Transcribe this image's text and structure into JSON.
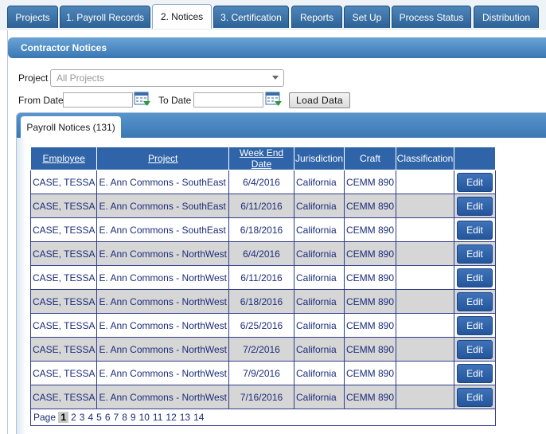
{
  "tabs": [
    {
      "label": "Projects",
      "active": false
    },
    {
      "label": "1. Payroll Records",
      "active": false
    },
    {
      "label": "2. Notices",
      "active": true
    },
    {
      "label": "3. Certification",
      "active": false
    },
    {
      "label": "Reports",
      "active": false
    },
    {
      "label": "Set Up",
      "active": false
    },
    {
      "label": "Process Status",
      "active": false
    },
    {
      "label": "Distribution",
      "active": false
    }
  ],
  "section": {
    "title": "Contractor Notices"
  },
  "filters": {
    "project_label": "Project",
    "project_placeholder": "All Projects",
    "from_label": "From Date",
    "from_value": "",
    "to_label": "To Date",
    "to_value": "",
    "load_label": "Load Data"
  },
  "panel": {
    "tab_label": "Payroll Notices (131)"
  },
  "grid": {
    "columns": [
      "Employee",
      "Project",
      "Week End Date",
      "Jurisdiction",
      "Craft",
      "Classification",
      ""
    ],
    "rows": [
      {
        "employee": "CASE, TESSA",
        "project": "E. Ann Commons - SouthEast",
        "week_end": "6/4/2016",
        "jurisdiction": "California",
        "craft": "CEMM 890",
        "classification": "",
        "action": "Edit"
      },
      {
        "employee": "CASE, TESSA",
        "project": "E. Ann Commons - SouthEast",
        "week_end": "6/11/2016",
        "jurisdiction": "California",
        "craft": "CEMM 890",
        "classification": "",
        "action": "Edit"
      },
      {
        "employee": "CASE, TESSA",
        "project": "E. Ann Commons - SouthEast",
        "week_end": "6/18/2016",
        "jurisdiction": "California",
        "craft": "CEMM 890",
        "classification": "",
        "action": "Edit"
      },
      {
        "employee": "CASE, TESSA",
        "project": "E. Ann Commons - NorthWest",
        "week_end": "6/4/2016",
        "jurisdiction": "California",
        "craft": "CEMM 890",
        "classification": "",
        "action": "Edit"
      },
      {
        "employee": "CASE, TESSA",
        "project": "E. Ann Commons - NorthWest",
        "week_end": "6/11/2016",
        "jurisdiction": "California",
        "craft": "CEMM 890",
        "classification": "",
        "action": "Edit"
      },
      {
        "employee": "CASE, TESSA",
        "project": "E. Ann Commons - NorthWest",
        "week_end": "6/18/2016",
        "jurisdiction": "California",
        "craft": "CEMM 890",
        "classification": "",
        "action": "Edit"
      },
      {
        "employee": "CASE, TESSA",
        "project": "E. Ann Commons - NorthWest",
        "week_end": "6/25/2016",
        "jurisdiction": "California",
        "craft": "CEMM 890",
        "classification": "",
        "action": "Edit"
      },
      {
        "employee": "CASE, TESSA",
        "project": "E. Ann Commons - NorthWest",
        "week_end": "7/2/2016",
        "jurisdiction": "California",
        "craft": "CEMM 890",
        "classification": "",
        "action": "Edit"
      },
      {
        "employee": "CASE, TESSA",
        "project": "E. Ann Commons - NorthWest",
        "week_end": "7/9/2016",
        "jurisdiction": "California",
        "craft": "CEMM 890",
        "classification": "",
        "action": "Edit"
      },
      {
        "employee": "CASE, TESSA",
        "project": "E. Ann Commons - NorthWest",
        "week_end": "7/16/2016",
        "jurisdiction": "California",
        "craft": "CEMM 890",
        "classification": "",
        "action": "Edit"
      }
    ]
  },
  "pager": {
    "label": "Page",
    "pages": [
      "1",
      "2",
      "3",
      "4",
      "5",
      "6",
      "7",
      "8",
      "9",
      "10",
      "11",
      "12",
      "13",
      "14"
    ],
    "current": "1"
  },
  "icons": {
    "calendar": "calendar-icon",
    "dropdown": "chevron-down-icon"
  },
  "colors": {
    "tab_blue": "#2d6296",
    "header_blue": "#3a78b3",
    "grid_header": "#2f64a8",
    "grid_text": "#1c2d7a",
    "alt_row": "#d6d6d6"
  }
}
